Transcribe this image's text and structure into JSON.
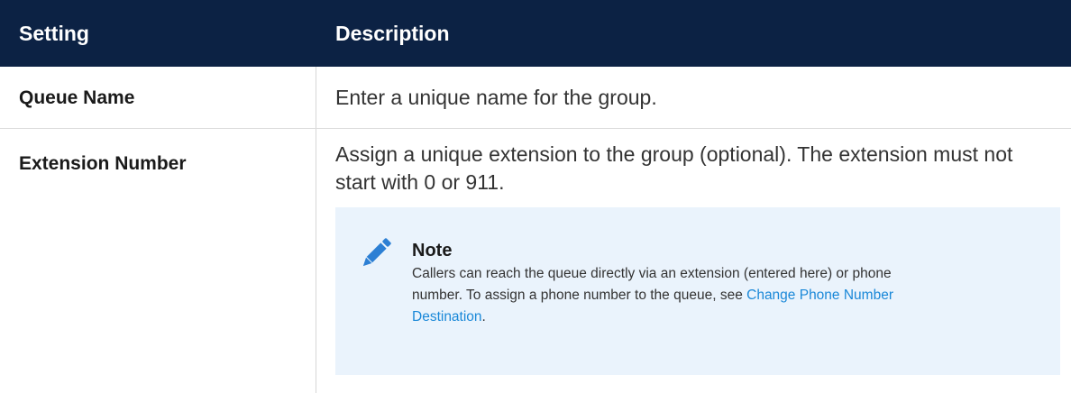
{
  "header": {
    "setting_label": "Setting",
    "description_label": "Description"
  },
  "rows": [
    {
      "setting": "Queue Name",
      "description": "Enter a unique name for the group."
    },
    {
      "setting": "Extension Number",
      "description": "Assign a unique extension to the group (optional). The extension must not start with 0 or 911.",
      "note": {
        "icon": "pencil-icon",
        "title": "Note",
        "text_before_link": "Callers can reach the queue directly via an extension (entered here) or phone number. To assign a phone number to the queue, see ",
        "link_text": "Change Phone Number Destination",
        "text_after_link": "."
      }
    }
  ],
  "colors": {
    "header_bg": "#0c2244",
    "note_bg": "#eaf3fc",
    "link": "#1a88d8",
    "icon": "#2c7fd4"
  }
}
